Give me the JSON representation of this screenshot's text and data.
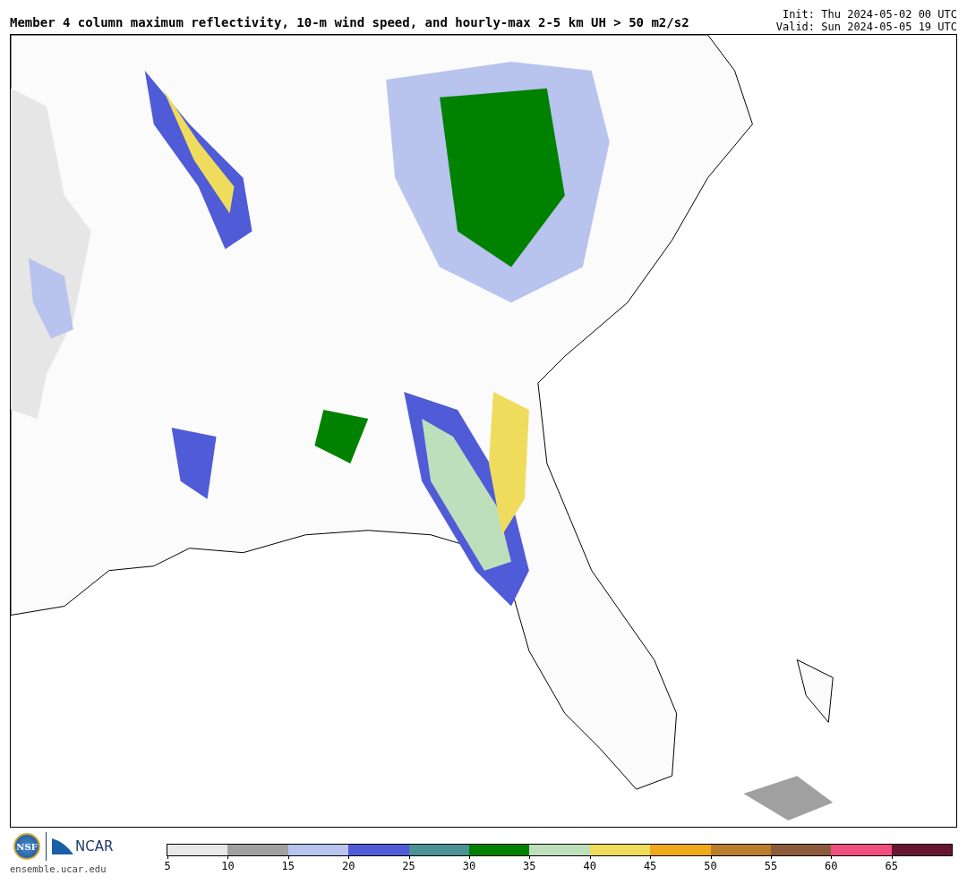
{
  "header": {
    "title": "Member 4 column maximum reflectivity, 10-m wind speed, and hourly-max 2-5 km UH > 50 m2/s2",
    "init": "Init: Thu 2024-05-02 00 UTC",
    "valid": "Valid: Sun 2024-05-05 19 UTC"
  },
  "footer": {
    "nsf_logo": "NSF",
    "ncar_logo": "NCAR",
    "site": "ensemble.ucar.edu"
  },
  "colorbar": {
    "segments": [
      {
        "label": "5",
        "color": "#e8e8e8"
      },
      {
        "label": "10",
        "color": "#a0a0a0"
      },
      {
        "label": "15",
        "color": "#b8c3ee"
      },
      {
        "label": "20",
        "color": "#505bd8"
      },
      {
        "label": "25",
        "color": "#4a9296"
      },
      {
        "label": "30",
        "color": "#008200"
      },
      {
        "label": "35",
        "color": "#bedfbc"
      },
      {
        "label": "40",
        "color": "#efdc5c"
      },
      {
        "label": "45",
        "color": "#eeaa1a"
      },
      {
        "label": "50",
        "color": "#bb7c2b"
      },
      {
        "label": "55",
        "color": "#8b5b3c"
      },
      {
        "label": "60",
        "color": "#f04f7d"
      },
      {
        "label": "65",
        "color": "#661532"
      }
    ]
  }
}
